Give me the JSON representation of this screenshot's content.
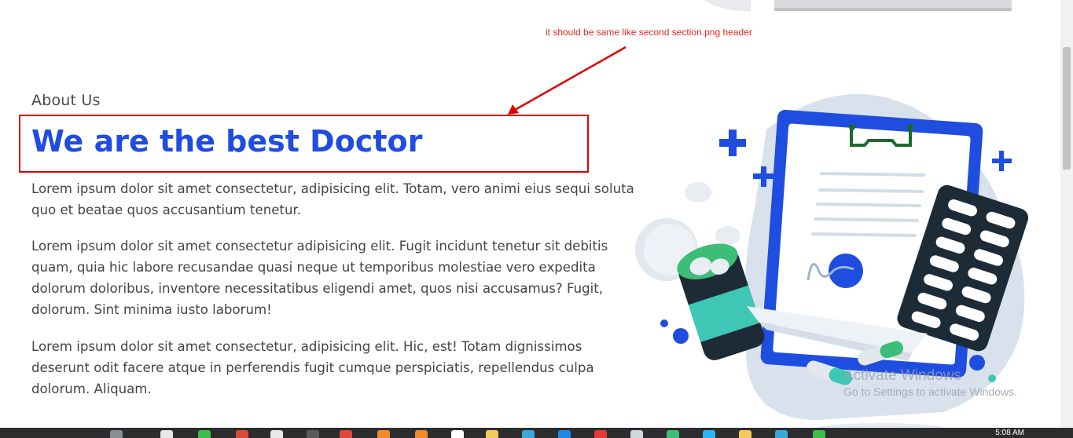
{
  "annotation": {
    "note": "it should be same like second section.png header"
  },
  "about": {
    "label": "About Us",
    "heading": "We are the best Doctor",
    "paragraphs": [
      "Lorem ipsum dolor sit amet consectetur, adipisicing elit. Totam, vero animi eius sequi soluta quo et beatae quos accusantium tenetur.",
      "Lorem ipsum dolor sit amet consectetur adipisicing elit. Fugit incidunt tenetur sit debitis quam, quia hic labore recusandae quasi neque ut temporibus molestiae vero expedita dolorum doloribus, inventore necessitatibus eligendi amet, quos nisi accusamus? Fugit, dolorum. Sint minima iusto laborum!",
      "Lorem ipsum dolor sit amet consectetur, adipisicing elit. Hic, est! Totam dignissimos deserunt odit facere atque in perferendis fugit cumque perspiciatis, repellendus culpa dolorum. Aliquam."
    ]
  },
  "watermark": {
    "line1": "Activate Windows",
    "line2": "Go to Settings to activate Windows."
  },
  "taskbar": {
    "clock": "5:08 AM"
  },
  "colors": {
    "heading": "#1f4de0",
    "annotation": "#e2271f",
    "clipboard": "#1f4de0",
    "pill_case": "#1d2b36",
    "bottle_green": "#3dbd77"
  }
}
